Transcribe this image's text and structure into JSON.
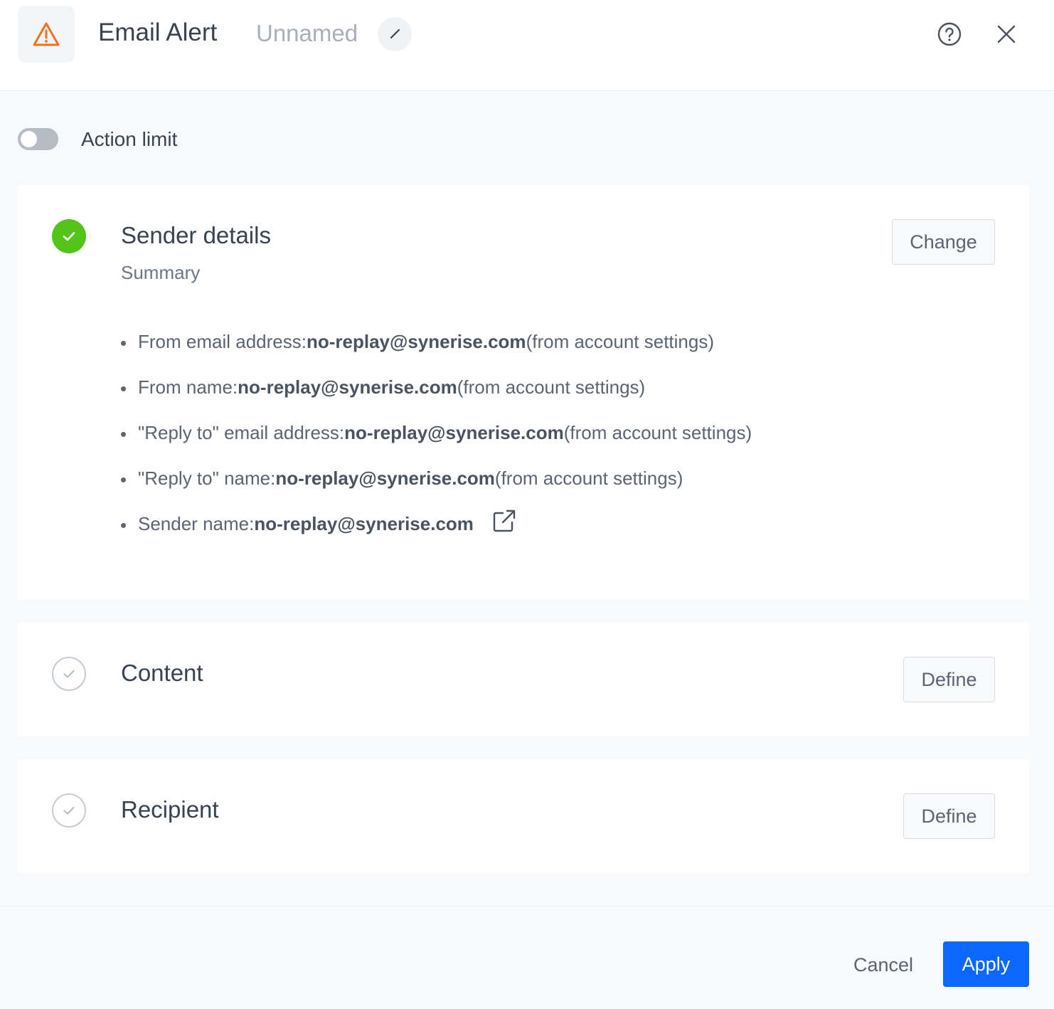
{
  "header": {
    "title": "Email Alert",
    "name": "Unnamed",
    "icon": "warning-icon",
    "icon_color": "#f37021"
  },
  "action_limit": {
    "label": "Action limit",
    "enabled": false
  },
  "steps": {
    "sender": {
      "title": "Sender details",
      "subtitle": "Summary",
      "status": "done",
      "button": "Change",
      "items": [
        {
          "label": "From email address: ",
          "value": "no-replay@synerise.com",
          "suffix": " (from account settings)"
        },
        {
          "label": "From name: ",
          "value": "no-replay@synerise.com",
          "suffix": " (from account settings)"
        },
        {
          "label": "\"Reply to\" email address: ",
          "value": "no-replay@synerise.com",
          "suffix": " (from account settings)"
        },
        {
          "label": "\"Reply to\" name: ",
          "value": "no-replay@synerise.com",
          "suffix": " (from account settings)"
        },
        {
          "label": "Sender name: ",
          "value": "no-replay@synerise.com",
          "suffix": ""
        }
      ]
    },
    "content": {
      "title": "Content",
      "status": "todo",
      "button": "Define"
    },
    "recipient": {
      "title": "Recipient",
      "status": "todo",
      "button": "Define"
    }
  },
  "footer": {
    "cancel": "Cancel",
    "apply": "Apply"
  },
  "colors": {
    "primary": "#0b68ff",
    "success": "#52c41a",
    "warning": "#f37021"
  }
}
